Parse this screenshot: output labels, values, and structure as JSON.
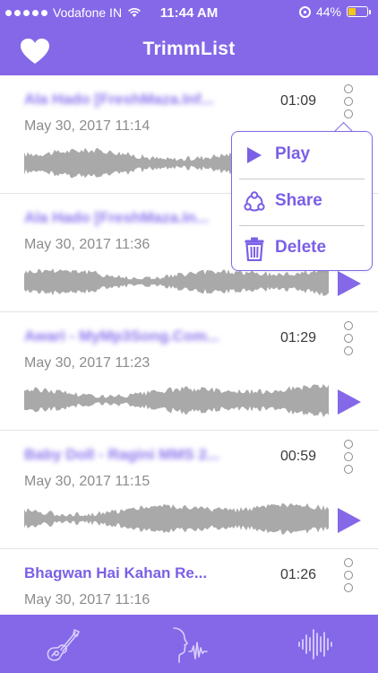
{
  "status_bar": {
    "carrier": "Vodafone IN",
    "time": "11:44 AM",
    "battery_percent": "44%",
    "battery_level": 0.44
  },
  "header": {
    "title": "TrimmList",
    "left_icon": "heart-icon"
  },
  "rows": [
    {
      "title": "Ala Hado  [FreshMaza.Inf...",
      "duration": "01:09",
      "date": "May 30, 2017 11:14",
      "blurred": true
    },
    {
      "title": "Ala Hado  [FreshMaza.In...",
      "duration": "",
      "date": "May 30, 2017 11:36",
      "blurred": true
    },
    {
      "title": "Awari - MyMp3Song.Com...",
      "duration": "01:29",
      "date": "May 30, 2017 11:23",
      "blurred": true
    },
    {
      "title": "Baby Doll - Ragini MMS 2...",
      "duration": "00:59",
      "date": "May 30, 2017 11:15",
      "blurred": true
    },
    {
      "title": "Bhagwan Hai Kahan Re...",
      "duration": "01:26",
      "date": "May 30, 2017 11:16",
      "blurred": false
    }
  ],
  "menu": {
    "play": "Play",
    "share": "Share",
    "delete": "Delete"
  },
  "tabs": [
    "guitar-icon",
    "voice-icon",
    "waveform-icon"
  ],
  "colors": {
    "accent": "#8468e8",
    "waveform": "#a9a9a9",
    "battery": "#f5c518"
  }
}
